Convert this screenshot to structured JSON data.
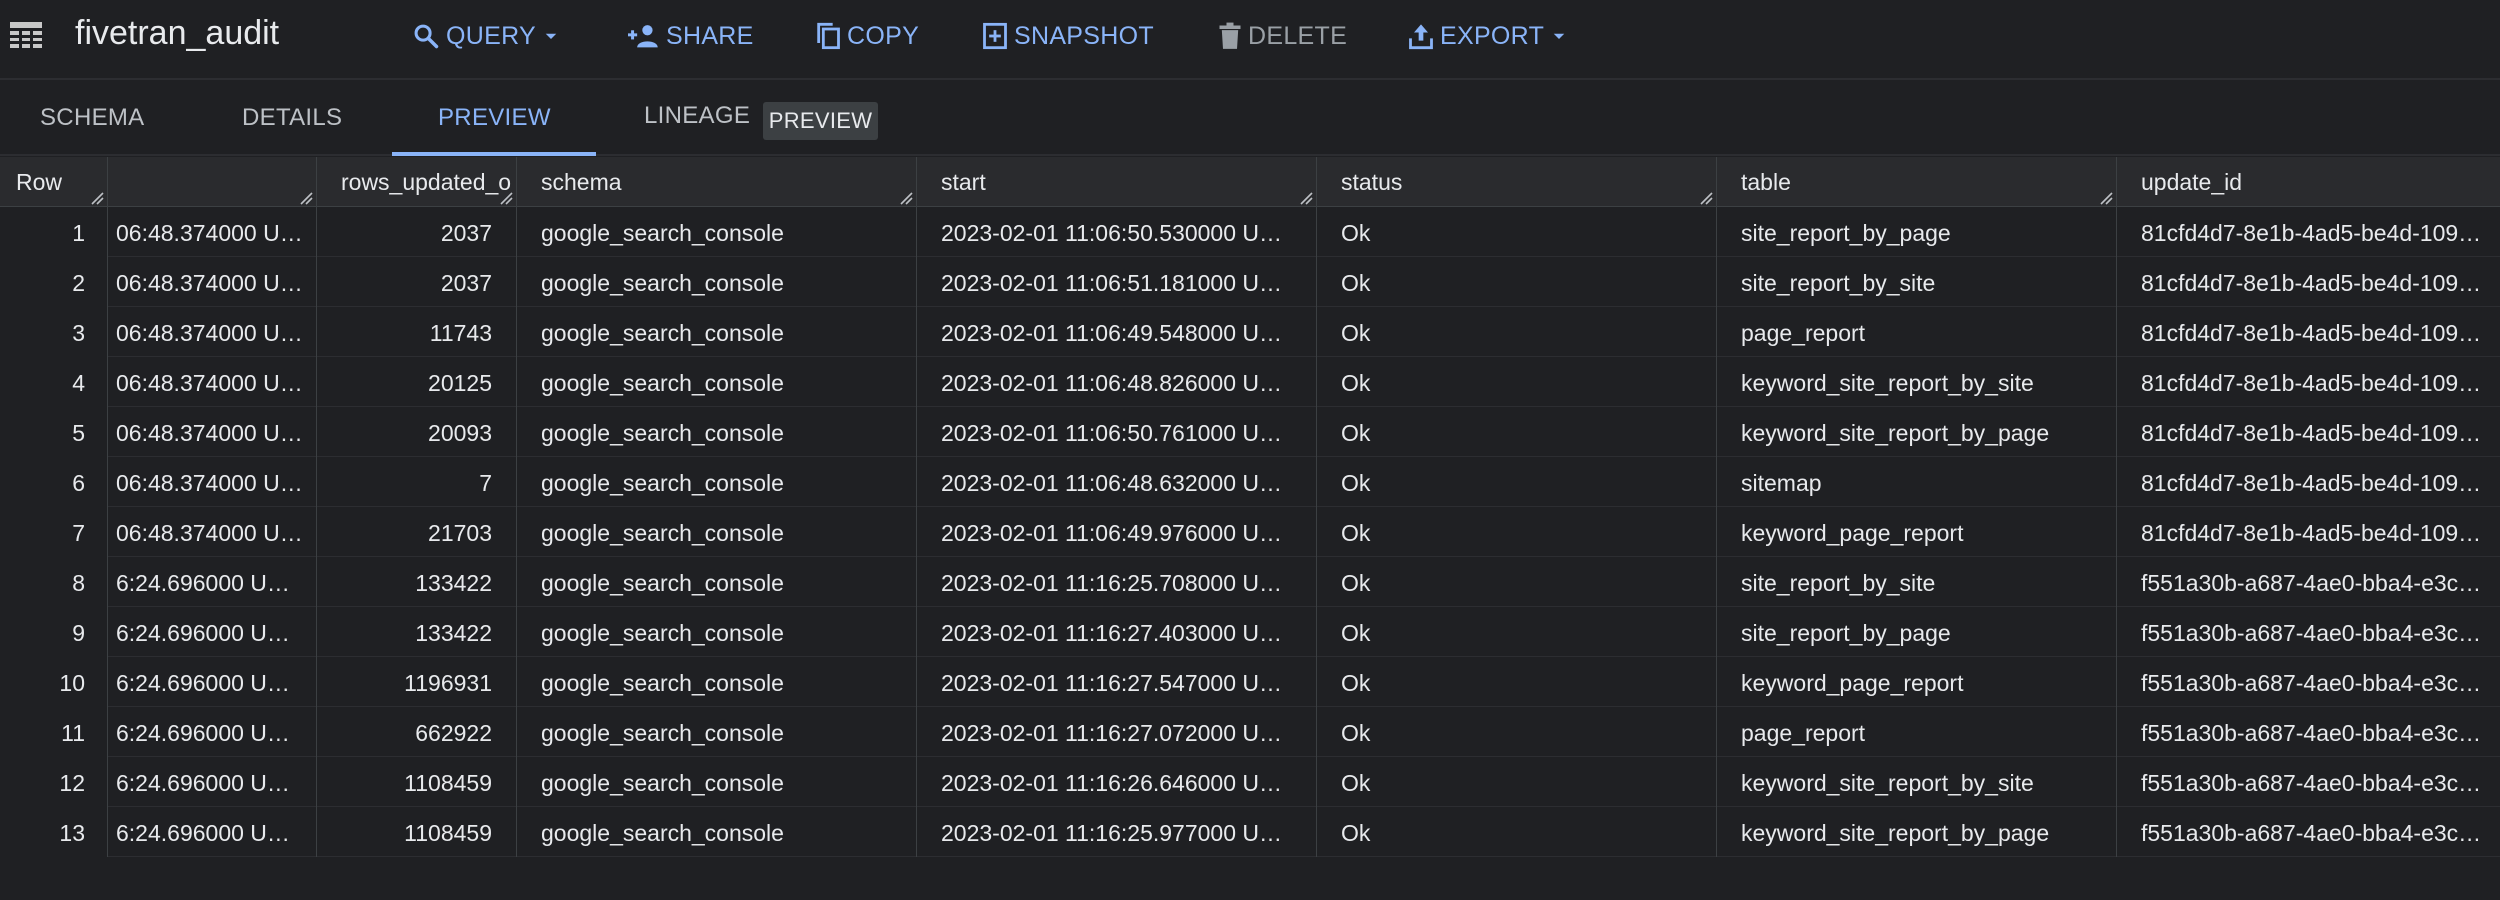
{
  "toolbar": {
    "title": "fivetran_audit",
    "query_label": "QUERY",
    "share_label": "SHARE",
    "copy_label": "COPY",
    "snapshot_label": "SNAPSHOT",
    "delete_label": "DELETE",
    "export_label": "EXPORT"
  },
  "tabs": {
    "schema": "SCHEMA",
    "details": "DETAILS",
    "preview": "PREVIEW",
    "lineage": "LINEAGE",
    "lineage_badge": "PREVIEW"
  },
  "colors": {
    "accent": "#8ab4f8",
    "background": "#1f2023",
    "header_bg": "#2a2b2e"
  },
  "grid": {
    "headers": {
      "row": "Row",
      "ts": "",
      "rows_updated": "rows_updated_o",
      "schema": "schema",
      "start": "start",
      "status": "status",
      "table": "table",
      "update_id": "update_id"
    },
    "rows": [
      {
        "row": "1",
        "ts": "06:48.374000 U…",
        "rows_updated": "2037",
        "schema": "google_search_console",
        "start": "2023-02-01 11:06:50.530000 U…",
        "status": "Ok",
        "table": "site_report_by_page",
        "update_id": "81cfd4d7-8e1b-4ad5-be4d-109…"
      },
      {
        "row": "2",
        "ts": "06:48.374000 U…",
        "rows_updated": "2037",
        "schema": "google_search_console",
        "start": "2023-02-01 11:06:51.181000 U…",
        "status": "Ok",
        "table": "site_report_by_site",
        "update_id": "81cfd4d7-8e1b-4ad5-be4d-109…"
      },
      {
        "row": "3",
        "ts": "06:48.374000 U…",
        "rows_updated": "11743",
        "schema": "google_search_console",
        "start": "2023-02-01 11:06:49.548000 U…",
        "status": "Ok",
        "table": "page_report",
        "update_id": "81cfd4d7-8e1b-4ad5-be4d-109…"
      },
      {
        "row": "4",
        "ts": "06:48.374000 U…",
        "rows_updated": "20125",
        "schema": "google_search_console",
        "start": "2023-02-01 11:06:48.826000 U…",
        "status": "Ok",
        "table": "keyword_site_report_by_site",
        "update_id": "81cfd4d7-8e1b-4ad5-be4d-109…"
      },
      {
        "row": "5",
        "ts": "06:48.374000 U…",
        "rows_updated": "20093",
        "schema": "google_search_console",
        "start": "2023-02-01 11:06:50.761000 U…",
        "status": "Ok",
        "table": "keyword_site_report_by_page",
        "update_id": "81cfd4d7-8e1b-4ad5-be4d-109…"
      },
      {
        "row": "6",
        "ts": "06:48.374000 U…",
        "rows_updated": "7",
        "schema": "google_search_console",
        "start": "2023-02-01 11:06:48.632000 U…",
        "status": "Ok",
        "table": "sitemap",
        "update_id": "81cfd4d7-8e1b-4ad5-be4d-109…"
      },
      {
        "row": "7",
        "ts": "06:48.374000 U…",
        "rows_updated": "21703",
        "schema": "google_search_console",
        "start": "2023-02-01 11:06:49.976000 U…",
        "status": "Ok",
        "table": "keyword_page_report",
        "update_id": "81cfd4d7-8e1b-4ad5-be4d-109…"
      },
      {
        "row": "8",
        "ts": "6:24.696000 U…",
        "rows_updated": "133422",
        "schema": "google_search_console",
        "start": "2023-02-01 11:16:25.708000 U…",
        "status": "Ok",
        "table": "site_report_by_site",
        "update_id": "f551a30b-a687-4ae0-bba4-e3c…"
      },
      {
        "row": "9",
        "ts": "6:24.696000 U…",
        "rows_updated": "133422",
        "schema": "google_search_console",
        "start": "2023-02-01 11:16:27.403000 U…",
        "status": "Ok",
        "table": "site_report_by_page",
        "update_id": "f551a30b-a687-4ae0-bba4-e3c…"
      },
      {
        "row": "10",
        "ts": "6:24.696000 U…",
        "rows_updated": "1196931",
        "schema": "google_search_console",
        "start": "2023-02-01 11:16:27.547000 U…",
        "status": "Ok",
        "table": "keyword_page_report",
        "update_id": "f551a30b-a687-4ae0-bba4-e3c…"
      },
      {
        "row": "11",
        "ts": "6:24.696000 U…",
        "rows_updated": "662922",
        "schema": "google_search_console",
        "start": "2023-02-01 11:16:27.072000 U…",
        "status": "Ok",
        "table": "page_report",
        "update_id": "f551a30b-a687-4ae0-bba4-e3c…"
      },
      {
        "row": "12",
        "ts": "6:24.696000 U…",
        "rows_updated": "1108459",
        "schema": "google_search_console",
        "start": "2023-02-01 11:16:26.646000 U…",
        "status": "Ok",
        "table": "keyword_site_report_by_site",
        "update_id": "f551a30b-a687-4ae0-bba4-e3c…"
      },
      {
        "row": "13",
        "ts": "6:24.696000 U…",
        "rows_updated": "1108459",
        "schema": "google_search_console",
        "start": "2023-02-01 11:16:25.977000 U…",
        "status": "Ok",
        "table": "keyword_site_report_by_page",
        "update_id": "f551a30b-a687-4ae0-bba4-e3c…"
      }
    ]
  }
}
